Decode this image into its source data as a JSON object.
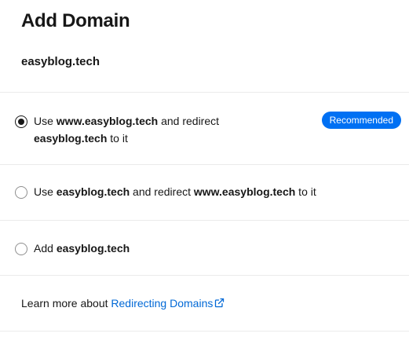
{
  "header": {
    "title": "Add Domain",
    "domain": "easyblog.tech"
  },
  "options": [
    {
      "selected": true,
      "prefix": "Use ",
      "bold1": "www.easyblog.tech",
      "middle": " and redirect ",
      "bold2": "easyblog.tech",
      "suffix": " to it",
      "badge": "Recommended"
    },
    {
      "selected": false,
      "prefix": "Use ",
      "bold1": "easyblog.tech",
      "middle": " and redirect ",
      "bold2": "www.easyblog.tech",
      "suffix": " to it"
    },
    {
      "selected": false,
      "prefix": "Add ",
      "bold1": "easyblog.tech"
    }
  ],
  "footer": {
    "text": "Learn more about ",
    "link": "Redirecting Domains",
    "link_icon": "external-link-icon"
  },
  "colors": {
    "accent": "#0070f3",
    "link": "#0068d6",
    "text": "#171717",
    "divider": "#ebebeb"
  }
}
